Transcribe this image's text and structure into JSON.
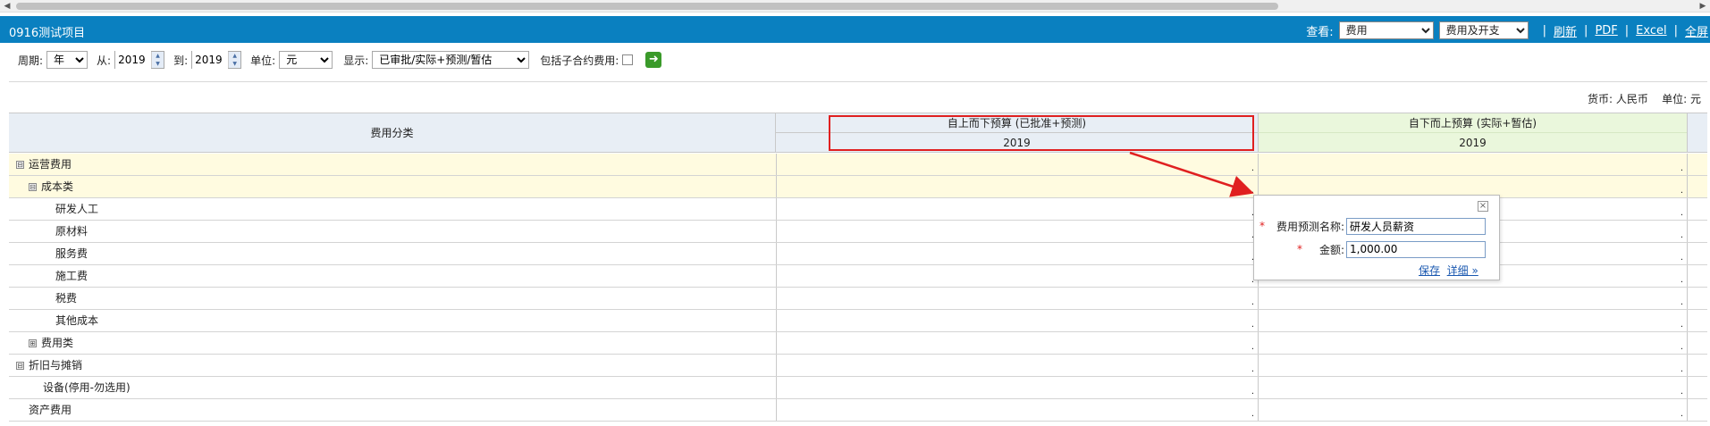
{
  "app": {
    "title": "0916测试项目"
  },
  "header": {
    "view_label": "查看:",
    "view_select": "费用",
    "type_select": "费用及开支",
    "links": [
      "刷新",
      "PDF",
      "Excel",
      "全屏"
    ],
    "separator": "|"
  },
  "filters": {
    "period_label": "周期:",
    "period_value": "年",
    "from_label": "从:",
    "from_value": "2019",
    "to_label": "到:",
    "to_value": "2019",
    "unit_label": "单位:",
    "unit_value": "元",
    "display_label": "显示:",
    "display_value": "已审批/实际+预测/暂估",
    "include_sub_label": "包括子合约费用:"
  },
  "currency_info": "货币: 人民币    单位: 元",
  "table": {
    "category_header": "费用分类",
    "topdown_header": "自上而下预算 (已批准+预测)",
    "topdown_year": "2019",
    "bottomup_header": "自下而上预算 (实际+暂估)",
    "bottomup_year": "2019",
    "rows": [
      {
        "name": "运营费用",
        "toggle": "⊟",
        "level": 0,
        "yellow": true
      },
      {
        "name": "成本类",
        "toggle": "⊟",
        "level": 1,
        "yellow": true
      },
      {
        "name": "研发人工",
        "toggle": "",
        "level": 2,
        "yellow": false
      },
      {
        "name": "原材料",
        "toggle": "",
        "level": 2,
        "yellow": false
      },
      {
        "name": "服务费",
        "toggle": "",
        "level": 2,
        "yellow": false
      },
      {
        "name": "施工费",
        "toggle": "",
        "level": 2,
        "yellow": false
      },
      {
        "name": "税费",
        "toggle": "",
        "level": 2,
        "yellow": false
      },
      {
        "name": "其他成本",
        "toggle": "",
        "level": 2,
        "yellow": false
      },
      {
        "name": "费用类",
        "toggle": "⊞",
        "level": 1,
        "yellow": false
      },
      {
        "name": "折旧与摊销",
        "toggle": "⊟",
        "level": 0,
        "yellow": false
      },
      {
        "name": "设备(停用-勿选用)",
        "toggle": "",
        "level": 1.5,
        "yellow": false
      },
      {
        "name": "资产费用",
        "toggle": "",
        "level": 0.5,
        "yellow": false
      }
    ],
    "cell_marker": "."
  },
  "popup": {
    "close": "×",
    "name_label": "费用预测名称:",
    "name_value": "研发人员薪资",
    "amount_label": "金额:",
    "amount_value": "1,000.00",
    "required_mark": "*",
    "save_link": "保存",
    "detail_link": "详细 »"
  },
  "colors": {
    "titlebar": "#0a80c0",
    "highlight_box": "#e02020",
    "arrow": "#e02020"
  }
}
